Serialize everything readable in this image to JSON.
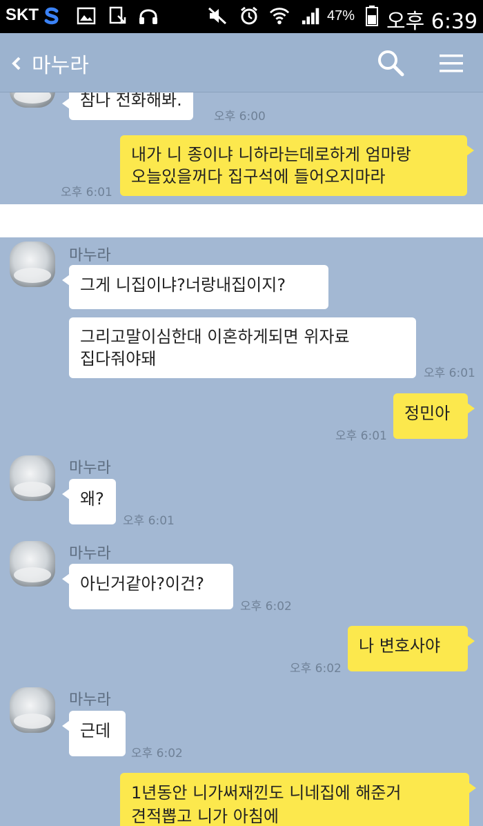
{
  "status_bar": {
    "carrier": "SKT",
    "battery_percent": "47%",
    "time": "오후 6:39",
    "icons": [
      "s-logo-icon",
      "gallery-icon",
      "download-icon",
      "headset-icon",
      "mute-icon",
      "alarm-icon",
      "wifi-icon",
      "signal-icon",
      "battery-icon"
    ]
  },
  "app_bar": {
    "back_icon": "chevron-left-icon",
    "title": "마누라",
    "search_icon": "search-icon",
    "menu_icon": "hamburger-menu-icon"
  },
  "contact_name": "마누라",
  "colors": {
    "chat_background": "#a3b8d3",
    "sent_bubble": "#fce84d",
    "received_bubble": "#ffffff",
    "app_bar": "#9cb3cf"
  },
  "panel1": {
    "msg1": {
      "direction": "received",
      "text": "참나 전화해봐.",
      "time": "오후 6:00"
    },
    "msg2": {
      "direction": "sent",
      "line1": "내가 니 종이냐 니하라는데로하게 엄마랑",
      "line2": "오늘있을꺼다 집구석에 들어오지마라",
      "time": "오후 6:01"
    }
  },
  "panel2": {
    "msg1": {
      "direction": "received",
      "text": "그게 니집이냐?너랑내집이지?"
    },
    "msg2": {
      "direction": "received",
      "line1": "그리고말이심한대 이혼하게되면 위자료",
      "line2": "집다줘야돼",
      "time": "오후 6:01"
    },
    "msg3": {
      "direction": "sent",
      "text": "정민아",
      "time": "오후 6:01"
    },
    "msg4": {
      "direction": "received",
      "text": "왜?",
      "time": "오후 6:01"
    },
    "msg5": {
      "direction": "received",
      "text": "아닌거같아?이건?",
      "time": "오후 6:02"
    },
    "msg6": {
      "direction": "sent",
      "text": "나 변호사야",
      "time": "오후 6:02"
    },
    "msg7": {
      "direction": "received",
      "text": "근데",
      "time": "오후 6:02"
    },
    "msg8": {
      "direction": "sent",
      "line1": "1년동안 니가써재낀도 니네집에 해준거",
      "line2": "견적뽑고 니가 아침에"
    }
  }
}
